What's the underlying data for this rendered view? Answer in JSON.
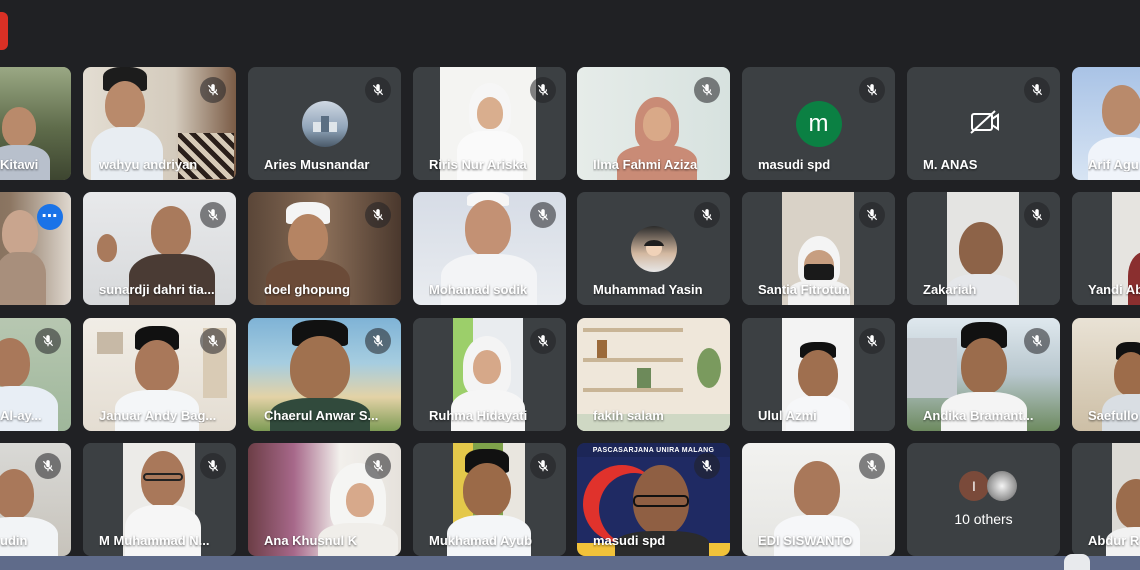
{
  "meeting": {
    "others_count_label": "10 others",
    "others_avatar_letter": "I"
  },
  "participants": [
    {
      "name": "Kitawi"
    },
    {
      "name": "wahyu andriyan"
    },
    {
      "name": "Aries Musnandar"
    },
    {
      "name": "Riris Nur Ariska"
    },
    {
      "name": "Ilma Fahmi Aziza"
    },
    {
      "name": "masudi spd",
      "avatar_letter": "m"
    },
    {
      "name": "M. ANAS"
    },
    {
      "name": "Arif Agu"
    },
    {
      "name": ""
    },
    {
      "name": "sunardji dahri tia..."
    },
    {
      "name": "doel ghopung"
    },
    {
      "name": "Mohamad sodik"
    },
    {
      "name": "Muhammad Yasin"
    },
    {
      "name": "Santia Fitrotun"
    },
    {
      "name": "Zakariah"
    },
    {
      "name": "Yandi Ab"
    },
    {
      "name": "Al-ay..."
    },
    {
      "name": "Januar Andy Bag..."
    },
    {
      "name": "Chaerul Anwar S..."
    },
    {
      "name": "Ruhma Hidayati"
    },
    {
      "name": "fakih salam"
    },
    {
      "name": "Ulul Azmi"
    },
    {
      "name": "Andika Bramant..."
    },
    {
      "name": "Saefullo"
    },
    {
      "name": "udin"
    },
    {
      "name": "M Muhammad N..."
    },
    {
      "name": "Ana Khusnul K"
    },
    {
      "name": "Mukhamad Ayub"
    },
    {
      "name": "masudi spd",
      "banner_text": "PASCASARJANA UNIRA MALANG"
    },
    {
      "name": "EDI SISWANTO"
    },
    {
      "name": "10 others"
    },
    {
      "name": "Abdur R"
    }
  ],
  "colors": {
    "background": "#202124",
    "tile": "#3c4043",
    "active_outline": "#8ab4f8",
    "more_button": "#1a73e8",
    "avatar_m": "#0b8043",
    "record_chip": "#d93025"
  },
  "icons": {
    "mute": "mic-off-icon",
    "camera_off": "camera-off-icon",
    "more": "more-options-icon"
  }
}
